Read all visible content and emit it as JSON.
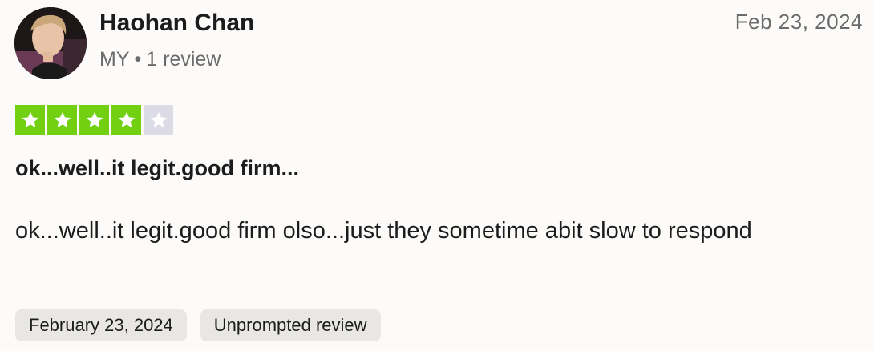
{
  "review": {
    "reviewer": {
      "name": "Haohan Chan",
      "country": "MY",
      "separator": "•",
      "review_count": "1 review"
    },
    "date_short": "Feb 23, 2024",
    "rating": 4,
    "rating_max": 5,
    "title": "ok...well..it legit.good firm...",
    "body": "ok...well..it legit.good firm olso...just they sometime abit slow to respond",
    "tags": {
      "date_full": "February 23, 2024",
      "type": "Unprompted review"
    }
  },
  "colors": {
    "star_filled": "#73cf11",
    "star_empty": "#dcdce6",
    "tag_bg": "#e8e7e3",
    "muted_text": "#6b6b6b"
  },
  "icons": {
    "avatar": "reviewer-avatar-photo",
    "star": "star-icon"
  }
}
